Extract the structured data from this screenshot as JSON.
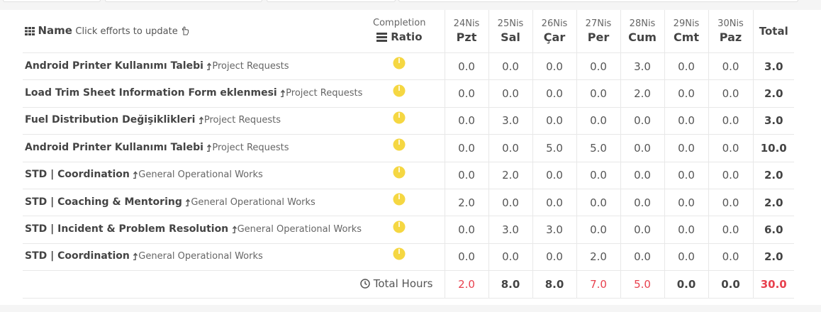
{
  "header": {
    "name_label": "Name",
    "name_hint": "Click efforts to update",
    "ratio_top": "Completion",
    "ratio_bottom": "Ratio",
    "days": [
      {
        "date": "24Nis",
        "name": "Pzt"
      },
      {
        "date": "25Nis",
        "name": "Sal"
      },
      {
        "date": "26Nis",
        "name": "Çar"
      },
      {
        "date": "27Nis",
        "name": "Per"
      },
      {
        "date": "28Nis",
        "name": "Cum"
      },
      {
        "date": "29Nis",
        "name": "Cmt"
      },
      {
        "date": "30Nis",
        "name": "Paz"
      }
    ],
    "total_label": "Total"
  },
  "rows": [
    {
      "task": "Android Printer Kullanımı Talebi",
      "project": "Project Requests",
      "values": [
        "0.0",
        "0.0",
        "0.0",
        "0.0",
        "3.0",
        "0.0",
        "0.0"
      ],
      "total": "3.0"
    },
    {
      "task": "Load Trim Sheet Information Form eklenmesi",
      "project": "Project Requests",
      "values": [
        "0.0",
        "0.0",
        "0.0",
        "0.0",
        "2.0",
        "0.0",
        "0.0"
      ],
      "total": "2.0"
    },
    {
      "task": "Fuel Distribution Değişiklikleri",
      "project": "Project Requests",
      "values": [
        "0.0",
        "3.0",
        "0.0",
        "0.0",
        "0.0",
        "0.0",
        "0.0"
      ],
      "total": "3.0"
    },
    {
      "task": "Android Printer Kullanımı Talebi",
      "project": "Project Requests",
      "values": [
        "0.0",
        "0.0",
        "5.0",
        "5.0",
        "0.0",
        "0.0",
        "0.0"
      ],
      "total": "10.0"
    },
    {
      "task": "STD | Coordination",
      "project": "General Operational Works",
      "values": [
        "0.0",
        "2.0",
        "0.0",
        "0.0",
        "0.0",
        "0.0",
        "0.0"
      ],
      "total": "2.0"
    },
    {
      "task": "STD | Coaching & Mentoring",
      "project": "General Operational Works",
      "values": [
        "2.0",
        "0.0",
        "0.0",
        "0.0",
        "0.0",
        "0.0",
        "0.0"
      ],
      "total": "2.0"
    },
    {
      "task": "STD | Incident & Problem Resolution",
      "project": "General Operational Works",
      "values": [
        "0.0",
        "3.0",
        "3.0",
        "0.0",
        "0.0",
        "0.0",
        "0.0"
      ],
      "total": "6.0"
    },
    {
      "task": "STD | Coordination",
      "project": "General Operational Works",
      "values": [
        "0.0",
        "0.0",
        "0.0",
        "2.0",
        "0.0",
        "0.0",
        "0.0"
      ],
      "total": "2.0"
    }
  ],
  "footer": {
    "label": "Total Hours",
    "values": [
      {
        "v": "2.0",
        "style": "red"
      },
      {
        "v": "8.0",
        "style": "normal"
      },
      {
        "v": "8.0",
        "style": "normal"
      },
      {
        "v": "7.0",
        "style": "red"
      },
      {
        "v": "5.0",
        "style": "red"
      },
      {
        "v": "0.0",
        "style": "normal"
      },
      {
        "v": "0.0",
        "style": "normal"
      }
    ],
    "total": "30.0"
  },
  "colors": {
    "pie_fill": "#f5d742",
    "pie_slice": "#c9a800",
    "red": "#e8414e"
  },
  "icons": {
    "name": "grid-icon",
    "hint": "hand-pointer-icon",
    "ratio": "list-icon",
    "project": "level-up-icon",
    "total_hours": "clock-icon",
    "ratio_cell": "pie-chart-icon"
  }
}
